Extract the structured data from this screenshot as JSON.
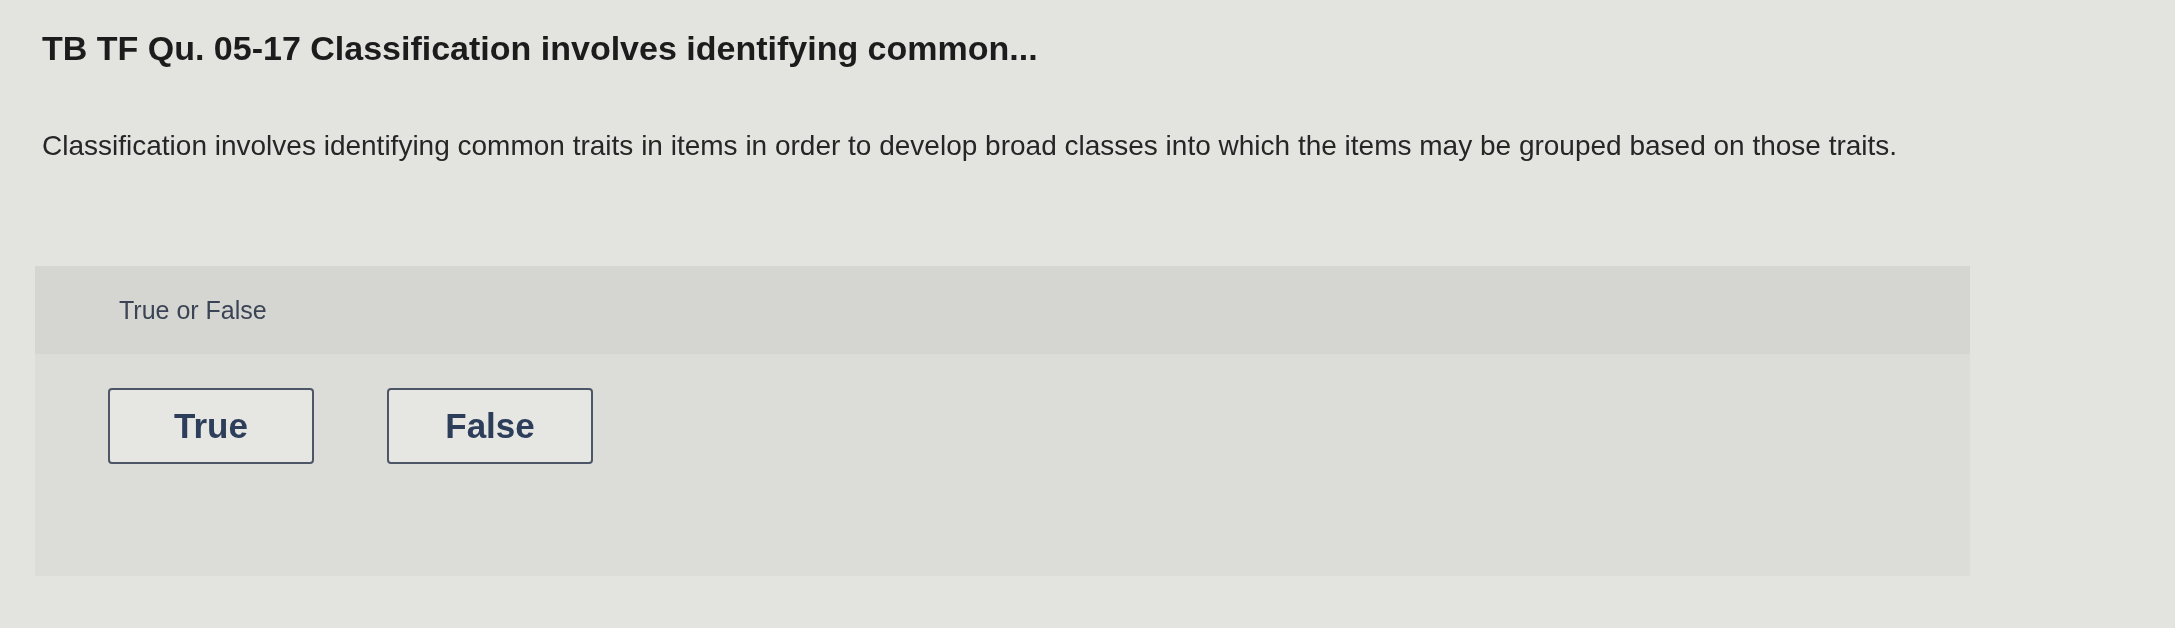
{
  "question": {
    "title": "TB TF Qu. 05-17 Classification involves identifying common...",
    "text": "Classification involves identifying common traits in items in order to develop broad classes into which the items may be grouped based on those traits."
  },
  "answer_panel": {
    "prompt": "True or False",
    "options": [
      {
        "label": "True",
        "selected": false
      },
      {
        "label": "False",
        "selected": false
      }
    ]
  }
}
